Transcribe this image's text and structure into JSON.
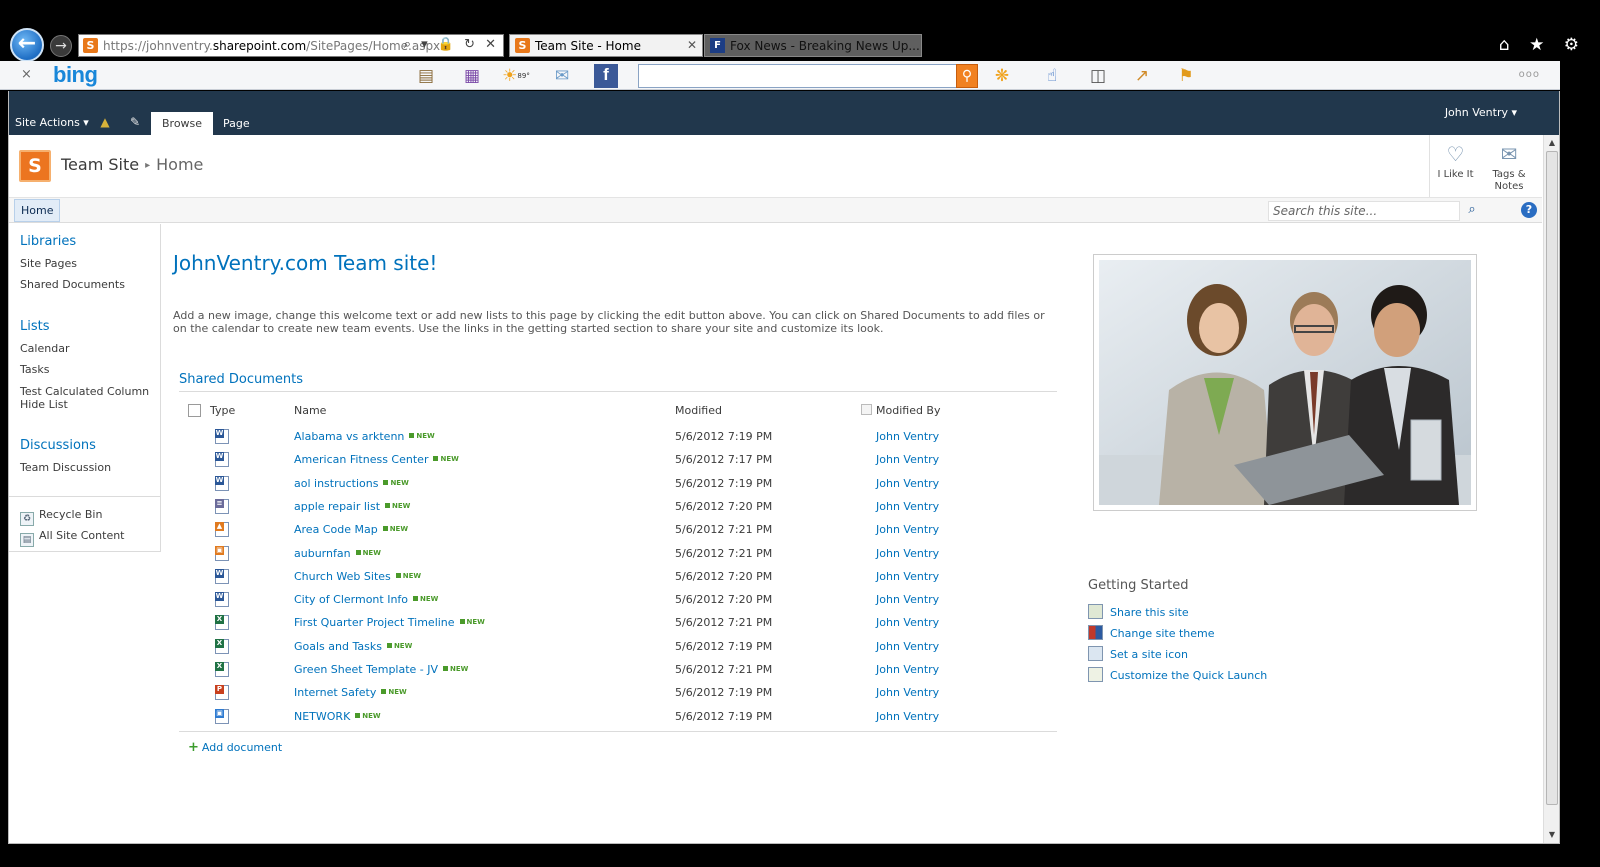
{
  "browser": {
    "back_icon": "back-arrow-icon",
    "forward_icon": "forward-arrow-icon",
    "url_prefix": "https://johnventry.",
    "url_domain": "sharepoint.com",
    "url_path": "/SitePages/Home.aspx",
    "addr_icons": "⌕ ▾ 🔒 ↻ ✕",
    "tabs": [
      {
        "label": "Team Site - Home",
        "close": "✕"
      },
      {
        "label": "Fox News - Breaking News Up..."
      }
    ],
    "right_icons": "⌂ ★ ⚙"
  },
  "bingbar": {
    "close": "×",
    "logo": "bing",
    "temperature": "89°",
    "more": "ooo"
  },
  "ribbon": {
    "site_actions": "Site Actions ▾",
    "tabs": [
      "Browse",
      "Page"
    ],
    "user": "John Ventry ▾"
  },
  "title": {
    "logo_letter": "S",
    "site": "Team Site",
    "separator": "▸",
    "page": "Home",
    "like_it": "I Like It",
    "tags_notes": "Tags & Notes"
  },
  "topnav": {
    "home": "Home",
    "search_placeholder": "Search this site...",
    "search_icon": "⌕",
    "help": "?"
  },
  "quicklaunch": {
    "sections": [
      {
        "head": "Libraries",
        "items": [
          "Site Pages",
          "Shared Documents"
        ]
      },
      {
        "head": "Lists",
        "items": [
          "Calendar",
          "Tasks",
          "Test Calculated Column Hide List"
        ]
      },
      {
        "head": "Discussions",
        "items": [
          "Team Discussion"
        ]
      }
    ],
    "utility": [
      "Recycle Bin",
      "All Site Content"
    ]
  },
  "main": {
    "welcome_title": "JohnVentry.com Team site!",
    "welcome_text": "Add a new image, change this welcome text or add new lists to this page by clicking the edit button above. You can click on Shared Documents to add files or on the calendar to create new team events. Use the links in the getting started section to share your site and customize its look.",
    "webpart_title": "Shared Documents",
    "columns": {
      "type": "Type",
      "name": "Name",
      "modified": "Modified",
      "modified_by": "Modified By"
    },
    "new_label": "NEW",
    "documents": [
      {
        "name": "Alabama vs arktenn",
        "modified": "5/6/2012 7:19 PM",
        "by": "John Ventry",
        "kind": "word"
      },
      {
        "name": "American Fitness Center",
        "modified": "5/6/2012 7:17 PM",
        "by": "John Ventry",
        "kind": "word"
      },
      {
        "name": "aol instructions",
        "modified": "5/6/2012 7:19 PM",
        "by": "John Ventry",
        "kind": "word"
      },
      {
        "name": "apple repair list",
        "modified": "5/6/2012 7:20 PM",
        "by": "John Ventry",
        "kind": "text"
      },
      {
        "name": "Area Code Map",
        "modified": "5/6/2012 7:21 PM",
        "by": "John Ventry",
        "kind": "image"
      },
      {
        "name": "auburnfan",
        "modified": "5/6/2012 7:21 PM",
        "by": "John Ventry",
        "kind": "image2"
      },
      {
        "name": "Church Web Sites",
        "modified": "5/6/2012 7:20 PM",
        "by": "John Ventry",
        "kind": "word"
      },
      {
        "name": "City of Clermont Info",
        "modified": "5/6/2012 7:20 PM",
        "by": "John Ventry",
        "kind": "word"
      },
      {
        "name": "First Quarter Project Timeline",
        "modified": "5/6/2012 7:21 PM",
        "by": "John Ventry",
        "kind": "excel"
      },
      {
        "name": "Goals and Tasks",
        "modified": "5/6/2012 7:19 PM",
        "by": "John Ventry",
        "kind": "excel"
      },
      {
        "name": "Green Sheet Template - JV",
        "modified": "5/6/2012 7:21 PM",
        "by": "John Ventry",
        "kind": "excel"
      },
      {
        "name": "Internet Safety",
        "modified": "5/6/2012 7:19 PM",
        "by": "John Ventry",
        "kind": "powerpoint"
      },
      {
        "name": "NETWORK",
        "modified": "5/6/2012 7:19 PM",
        "by": "John Ventry",
        "kind": "image3"
      }
    ],
    "add_document": "Add document",
    "add_icon": "+"
  },
  "getting_started": {
    "title": "Getting Started",
    "items": [
      "Share this site",
      "Change site theme",
      "Set a site icon",
      "Customize the Quick Launch"
    ]
  },
  "colors": {
    "link": "#0072bc",
    "ribbon": "#21374c",
    "new_badge": "#4a9a2a",
    "word": "#2b5797",
    "excel": "#207245",
    "powerpoint": "#c8401e",
    "image": "#e07a1f"
  }
}
